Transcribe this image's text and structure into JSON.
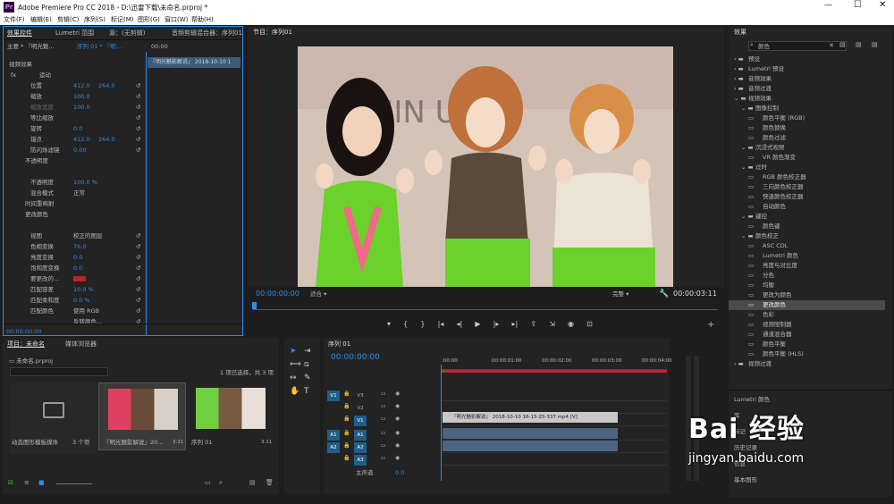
{
  "titlebar": {
    "title": "Adobe Premiere Pro CC 2018 - D:\\迅雷下载\\未命名.prproj *",
    "logo": "Pr"
  },
  "menu": [
    "文件(F)",
    "编辑(E)",
    "剪辑(C)",
    "序列(S)",
    "标记(M)",
    "图形(G)",
    "窗口(W)",
    "帮助(H)"
  ],
  "ec": {
    "tabs": [
      "效果控件",
      "Lumetri 范围",
      "源：(无剪辑)",
      "音频剪辑混合器：序列01"
    ],
    "master": "主要 * 『明光魅...",
    "seq": "序列 01 * 『明...",
    "timecode_top": "00:00",
    "clip_label": "『明光魅影解说』 2018-10-10 1",
    "video_effects": "视频效果",
    "motion": "运动",
    "rows": [
      {
        "label": "位置",
        "v1": "412.0",
        "v2": "264.0"
      },
      {
        "label": "缩放",
        "v1": "100.0",
        "v2": ""
      },
      {
        "label": "缩放宽度",
        "v1": "100.0",
        "v2": ""
      },
      {
        "label": "等比缩放",
        "v1": "",
        "v2": ""
      },
      {
        "label": "旋转",
        "v1": "0.0",
        "v2": ""
      },
      {
        "label": "锚点",
        "v1": "412.0",
        "v2": "264.0"
      },
      {
        "label": "防闪烁滤镜",
        "v1": "0.00",
        "v2": ""
      }
    ],
    "opacity": "不透明度",
    "opacity_val": "100.0 %",
    "blend_label": "混合模式",
    "blend_val": "正常",
    "time_remap": "时间重映射",
    "change_color": "更改颜色",
    "rows2": [
      {
        "label": "视图",
        "v1": "校正的图层"
      },
      {
        "label": "色相变换",
        "v1": "76.0"
      },
      {
        "label": "亮度变换",
        "v1": "0.0"
      },
      {
        "label": "饱和度变换",
        "v1": "0.0"
      },
      {
        "label": "要更改的...",
        "v1": ""
      },
      {
        "label": "匹配容差",
        "v1": "10.0 %"
      },
      {
        "label": "匹配柔和度",
        "v1": "0.0 %"
      },
      {
        "label": "匹配颜色",
        "v1": "使用 RGB"
      },
      {
        "label": "",
        "v1": "反转颜色..."
      }
    ],
    "bottom_tc": "00:00:00:00"
  },
  "program": {
    "tab": "节目：序列01",
    "tc_left": "00:00:00:00",
    "fit": "适合",
    "full": "完整",
    "tc_right": "00:00:03:11"
  },
  "project": {
    "tabs": [
      "项目：未命名",
      "媒体浏览器"
    ],
    "file": "未命名.prproj",
    "status": "1 项已选择，共 3 项",
    "items": [
      {
        "name": "动态图形模板媒体",
        "meta": "3 个项"
      },
      {
        "name": "『明光魅影解说』20...",
        "meta": "3:11"
      },
      {
        "name": "序列 01",
        "meta": "3:11"
      }
    ]
  },
  "timeline": {
    "tab": "序列 01",
    "tc": "00:00:00:00",
    "ruler": [
      ":00:00",
      "00:00:01:00",
      "00:00:02:00",
      "00:00:03:00",
      "00:00:04:00"
    ],
    "tracks": [
      "V3",
      "V2",
      "V1",
      "A1",
      "A2",
      "A3"
    ],
    "src": [
      "V1",
      "",
      "",
      "A1",
      "A2",
      ""
    ],
    "master": "主声道",
    "master_val": "0.0",
    "clip": "『明光魅影解说』 2018-10-10 16-15-25-337.mp4 [V]"
  },
  "effects": {
    "tab": "效果",
    "search": "颜色",
    "tree": [
      {
        "t": "预设",
        "d": 0,
        "k": "f"
      },
      {
        "t": "Lumetri 预设",
        "d": 0,
        "k": "f"
      },
      {
        "t": "音频效果",
        "d": 0,
        "k": "f"
      },
      {
        "t": "音频过渡",
        "d": 0,
        "k": "f"
      },
      {
        "t": "视频效果",
        "d": 0,
        "k": "f",
        "o": true
      },
      {
        "t": "图像控制",
        "d": 1,
        "k": "f",
        "o": true
      },
      {
        "t": "颜色平衡 (RGB)",
        "d": 2,
        "k": "e"
      },
      {
        "t": "颜色替换",
        "d": 2,
        "k": "e"
      },
      {
        "t": "颜色过滤",
        "d": 2,
        "k": "e"
      },
      {
        "t": "沉浸式视频",
        "d": 1,
        "k": "f",
        "o": true
      },
      {
        "t": "VR 颜色渐变",
        "d": 2,
        "k": "e"
      },
      {
        "t": "过时",
        "d": 1,
        "k": "f",
        "o": true
      },
      {
        "t": "RGB 颜色校正器",
        "d": 2,
        "k": "e"
      },
      {
        "t": "三向颜色校正器",
        "d": 2,
        "k": "e"
      },
      {
        "t": "快速颜色校正器",
        "d": 2,
        "k": "e"
      },
      {
        "t": "自动颜色",
        "d": 2,
        "k": "e"
      },
      {
        "t": "键控",
        "d": 1,
        "k": "f",
        "o": true
      },
      {
        "t": "颜色键",
        "d": 2,
        "k": "e"
      },
      {
        "t": "颜色校正",
        "d": 1,
        "k": "f",
        "o": true
      },
      {
        "t": "ASC CDL",
        "d": 2,
        "k": "e"
      },
      {
        "t": "Lumetri 颜色",
        "d": 2,
        "k": "e"
      },
      {
        "t": "亮度与对比度",
        "d": 2,
        "k": "e"
      },
      {
        "t": "分色",
        "d": 2,
        "k": "e"
      },
      {
        "t": "均衡",
        "d": 2,
        "k": "e"
      },
      {
        "t": "更改为颜色",
        "d": 2,
        "k": "e"
      },
      {
        "t": "更改颜色",
        "d": 2,
        "k": "e",
        "sel": true
      },
      {
        "t": "色彩",
        "d": 2,
        "k": "e"
      },
      {
        "t": "视频限制器",
        "d": 2,
        "k": "e"
      },
      {
        "t": "通道混合器",
        "d": 2,
        "k": "e"
      },
      {
        "t": "颜色平衡",
        "d": 2,
        "k": "e"
      },
      {
        "t": "颜色平衡 (HLS)",
        "d": 2,
        "k": "e"
      },
      {
        "t": "视频过渡",
        "d": 0,
        "k": "f"
      }
    ],
    "panels": [
      "Lumetri 颜色",
      "库",
      "标记",
      "历史记录",
      "信息",
      "基本图形"
    ]
  },
  "watermark": {
    "brand": "Bai 经验",
    "url": "jingyan.baidu.com"
  },
  "colors": {
    "accent": "#2d8ceb",
    "bg": "#232323",
    "clip_audio": "#4a6482",
    "track_blue": "#1e5e8a"
  }
}
